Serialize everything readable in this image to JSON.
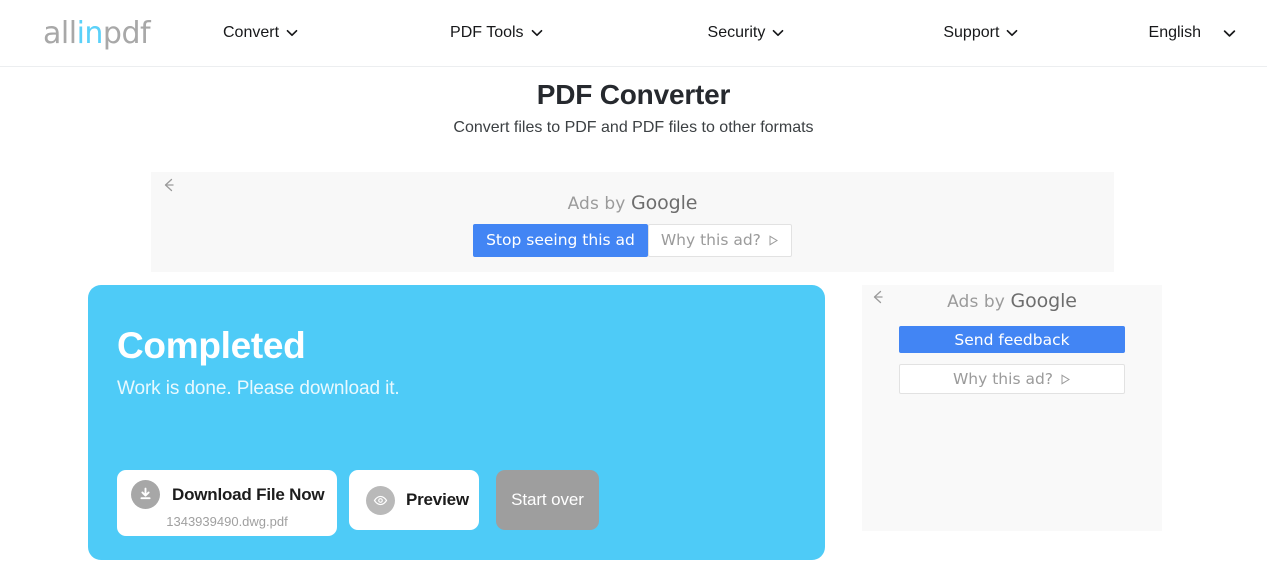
{
  "navbar": {
    "logo": {
      "part1": "all",
      "part2": "in",
      "part3": "pdf",
      "accent_color": "#5bd1f9",
      "base_color": "#a8a8a8"
    },
    "items": [
      {
        "label": "Convert",
        "icon": "chevron-down-icon"
      },
      {
        "label": "PDF Tools",
        "icon": "chevron-down-icon"
      },
      {
        "label": "Security",
        "icon": "chevron-down-icon"
      },
      {
        "label": "Support",
        "icon": "chevron-down-icon"
      }
    ],
    "language": {
      "label": "English",
      "icon": "chevron-down-icon"
    }
  },
  "header": {
    "title": "PDF Converter",
    "subtitle": "Convert files to PDF and PDF files to other formats"
  },
  "ad_top": {
    "back_icon": "arrow-left-icon",
    "attribution_prefix": "Ads by ",
    "attribution_brand": "Google",
    "stop_button": "Stop seeing this ad",
    "why_button": "Why this ad?",
    "why_icon": "play-triangle-icon",
    "accent_color": "#4285f4"
  },
  "result": {
    "title": "Completed",
    "subtitle": "Work is done. Please download it.",
    "card_color": "#4ecbf7",
    "download": {
      "label": "Download File Now",
      "filename": "1343939490.dwg.pdf",
      "icon": "download-icon"
    },
    "preview": {
      "label": "Preview",
      "icon": "eye-icon"
    },
    "start_over": {
      "label": "Start over"
    }
  },
  "ad_right": {
    "back_icon": "arrow-left-icon",
    "attribution_prefix": "Ads by ",
    "attribution_brand": "Google",
    "feedback_button": "Send feedback",
    "why_button": "Why this ad?",
    "why_icon": "play-triangle-icon",
    "accent_color": "#4285f4"
  }
}
